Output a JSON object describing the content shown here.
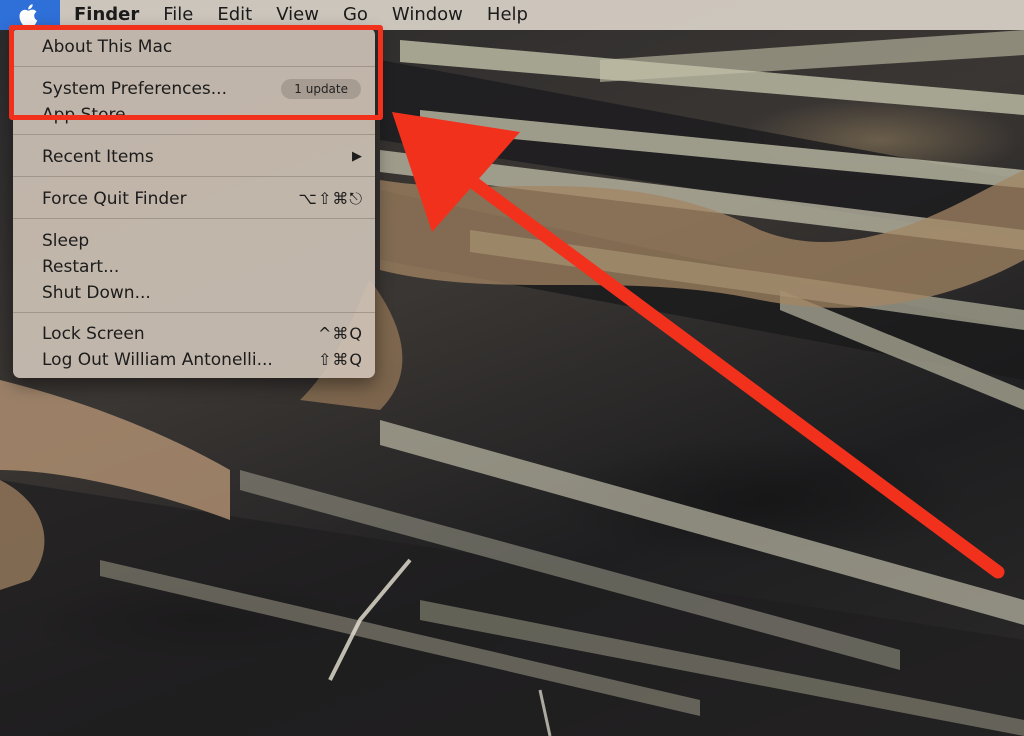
{
  "menubar": {
    "app_name": "Finder",
    "menus": [
      "File",
      "Edit",
      "View",
      "Go",
      "Window",
      "Help"
    ]
  },
  "apple_menu": {
    "items": [
      {
        "label": "About This Mac"
      },
      {
        "label": "System Preferences...",
        "badge": "1 update"
      },
      {
        "label": "App Store..."
      },
      {
        "label": "Recent Items",
        "submenu": "▶"
      },
      {
        "label": "Force Quit Finder",
        "shortcut": "⌥⇧⌘⎋"
      },
      {
        "label": "Sleep"
      },
      {
        "label": "Restart..."
      },
      {
        "label": "Shut Down..."
      },
      {
        "label": "Lock Screen",
        "shortcut": "^⌘Q"
      },
      {
        "label": "Log Out William Antonelli...",
        "shortcut": "⇧⌘Q"
      }
    ]
  },
  "annotation": {
    "color": "#f2311d"
  },
  "colors": {
    "apple_menu_highlight": "#2f6fd8"
  }
}
